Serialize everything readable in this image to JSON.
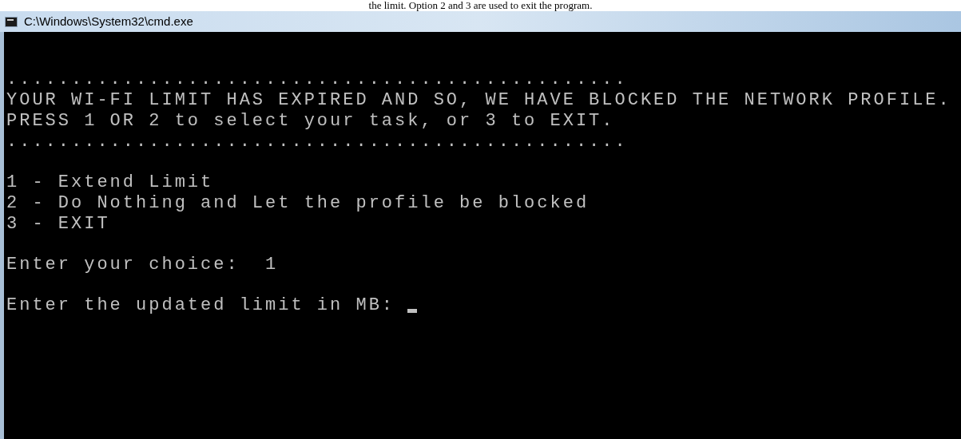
{
  "caption": "the limit. Option 2 and 3 are used to exit the program.",
  "window": {
    "title": "C:\\Windows\\System32\\cmd.exe"
  },
  "console": {
    "blocks": [
      [
        "................................................",
        "YOUR WI-FI LIMIT HAS EXPIRED AND SO, WE HAVE BLOCKED THE NETWORK PROFILE.",
        "PRESS 1 OR 2 to select your task, or 3 to EXIT.",
        "................................................"
      ],
      [
        "1 - Extend Limit",
        "2 - Do Nothing and Let the profile be blocked",
        "3 - EXIT"
      ],
      [
        "Enter your choice:  1"
      ],
      [
        "Enter the updated limit in MB: "
      ]
    ],
    "cursor": true
  }
}
